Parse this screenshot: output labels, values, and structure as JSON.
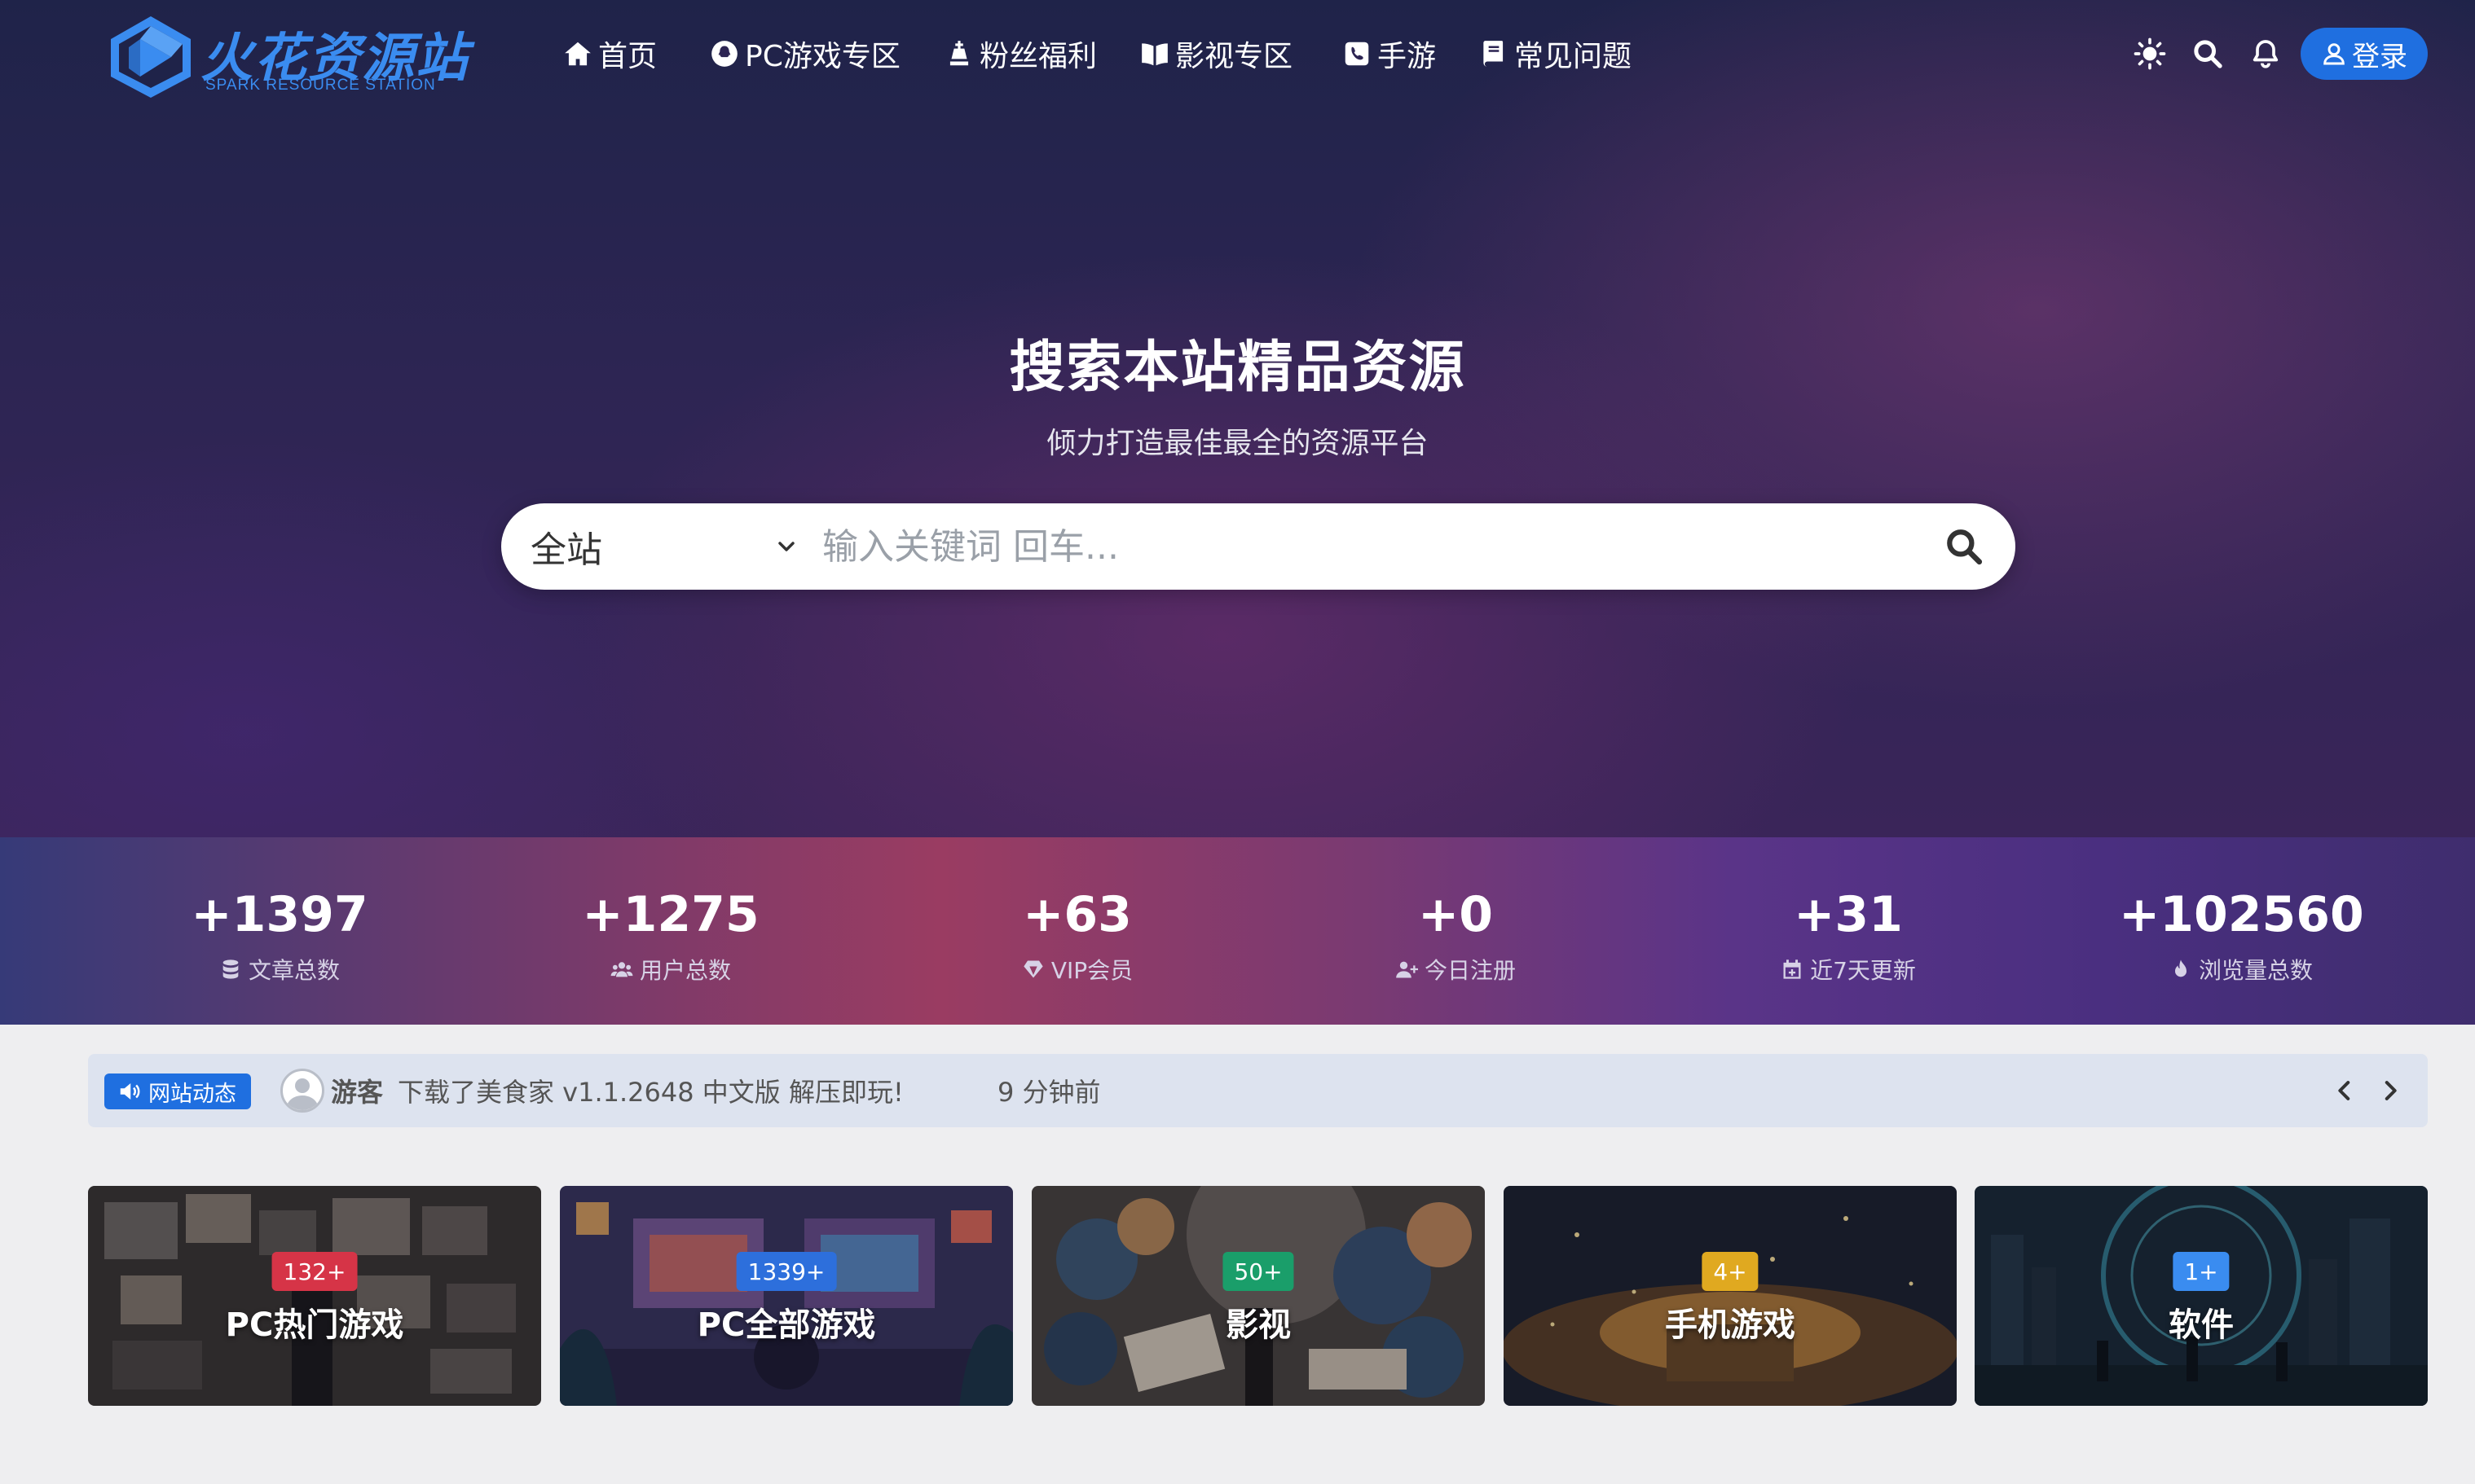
{
  "brand": {
    "title": "火花资源站",
    "subtitle": "SPARK RESOURCE STATION",
    "color": "#3a8cf0"
  },
  "nav": {
    "items": [
      {
        "label": "首页",
        "icon": "home-icon"
      },
      {
        "label": "PC游戏专区",
        "icon": "qq-icon"
      },
      {
        "label": "粉丝福利",
        "icon": "chess-king-icon"
      },
      {
        "label": "影视专区",
        "icon": "book-open-icon"
      },
      {
        "label": "手游",
        "icon": "phone-icon"
      },
      {
        "label": "常见问题",
        "icon": "book-icon"
      }
    ],
    "login_label": "登录",
    "accent": "#1f6fe0"
  },
  "hero": {
    "title": "搜索本站精品资源",
    "subtitle": "倾力打造最佳最全的资源平台",
    "search_scope": "全站",
    "search_placeholder": "输入关键词 回车..."
  },
  "stats": [
    {
      "value": "+1397",
      "label": "文章总数",
      "icon": "database-icon"
    },
    {
      "value": "+1275",
      "label": "用户总数",
      "icon": "users-icon"
    },
    {
      "value": "+63",
      "label": "VIP会员",
      "icon": "diamond-icon"
    },
    {
      "value": "+0",
      "label": "今日注册",
      "icon": "user-plus-icon"
    },
    {
      "value": "+31",
      "label": "近7天更新",
      "icon": "calendar-icon"
    },
    {
      "value": "+102560",
      "label": "浏览量总数",
      "icon": "fire-icon"
    }
  ],
  "announce": {
    "badge": "网站动态",
    "user": "游客",
    "text": "下载了美食家 v1.1.2648 中文版 解压即玩!",
    "time": "9 分钟前"
  },
  "categories": [
    {
      "badge": "132+",
      "title": "PC热门游戏",
      "badge_color": "#d63447"
    },
    {
      "badge": "1339+",
      "title": "PC全部游戏",
      "badge_color": "#2d6fdc"
    },
    {
      "badge": "50+",
      "title": "影视",
      "badge_color": "#1a9e6a"
    },
    {
      "badge": "4+",
      "title": "手机游戏",
      "badge_color": "#e0a920"
    },
    {
      "badge": "1+",
      "title": "软件",
      "badge_color": "#3a8cf0"
    }
  ]
}
